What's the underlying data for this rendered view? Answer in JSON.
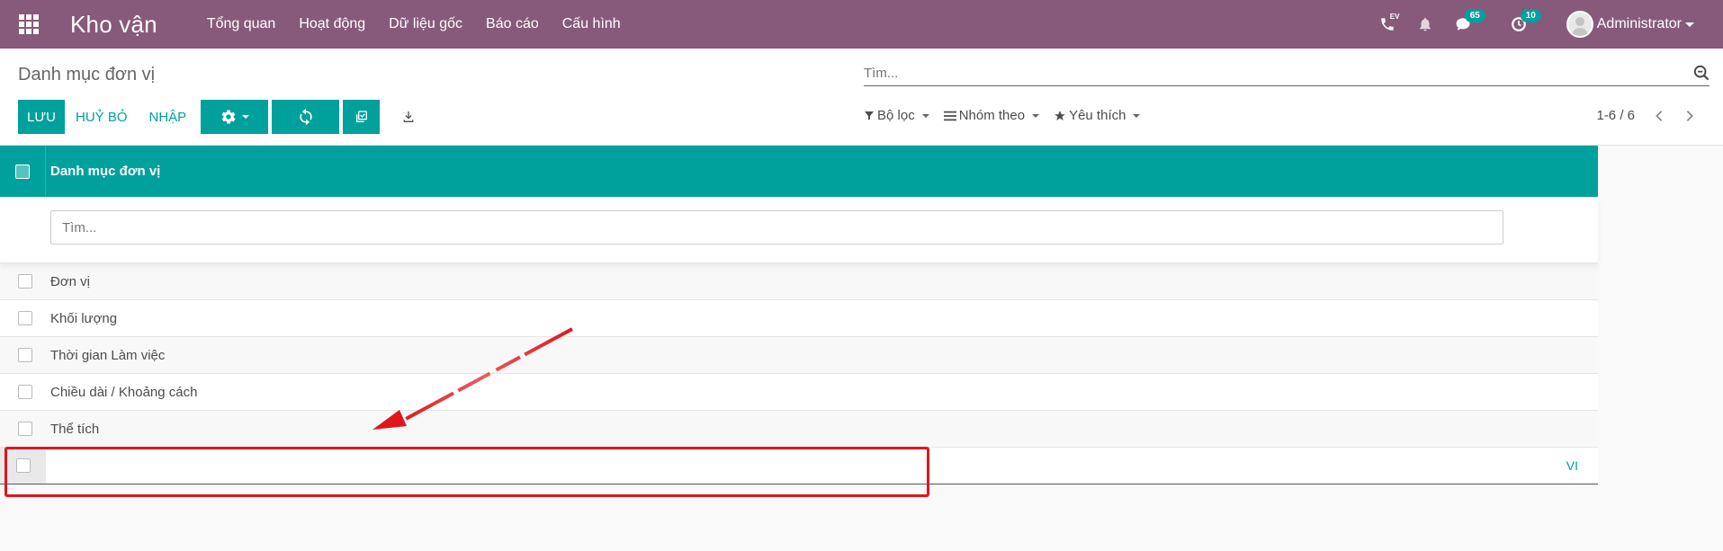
{
  "app": {
    "title": "Kho vận",
    "menu": [
      "Tổng quan",
      "Hoạt động",
      "Dữ liệu gốc",
      "Báo cáo",
      "Cấu hình"
    ]
  },
  "systray": {
    "voip_label": "EV",
    "messages_count": "65",
    "activities_count": "10",
    "user": "Administrator"
  },
  "control_panel": {
    "breadcrumb": "Danh mục đơn vị",
    "search_placeholder": "Tìm...",
    "buttons": {
      "save": "LƯU",
      "discard": "HUỶ BỎ",
      "import": "NHẬP"
    },
    "filters": {
      "filter": "Bộ lọc",
      "group_by": "Nhóm theo",
      "favorites": "Yêu thích"
    },
    "pager": "1-6 / 6"
  },
  "table": {
    "column_header": "Danh mục đơn vị",
    "filter_placeholder": "Tìm...",
    "rows": [
      {
        "label": "Đơn vị"
      },
      {
        "label": "Khối lượng"
      },
      {
        "label": "Thời gian Làm việc"
      },
      {
        "label": "Chiều dài / Khoảng cách"
      },
      {
        "label": "Thể tích"
      }
    ],
    "new_row": {
      "value": "",
      "lang": "VI"
    }
  },
  "colors": {
    "navbar": "#875a7b",
    "primary": "#00a09d",
    "annotation": "#e0161e"
  },
  "icons": [
    "apps-grid-icon",
    "phone-icon",
    "bell-icon",
    "chat-icon",
    "clock-icon",
    "gear-icon",
    "refresh-icon",
    "duplicate-icon",
    "download-icon",
    "filter-icon",
    "bars-icon",
    "star-icon",
    "chevron-left-icon",
    "chevron-right-icon",
    "search-icon"
  ]
}
